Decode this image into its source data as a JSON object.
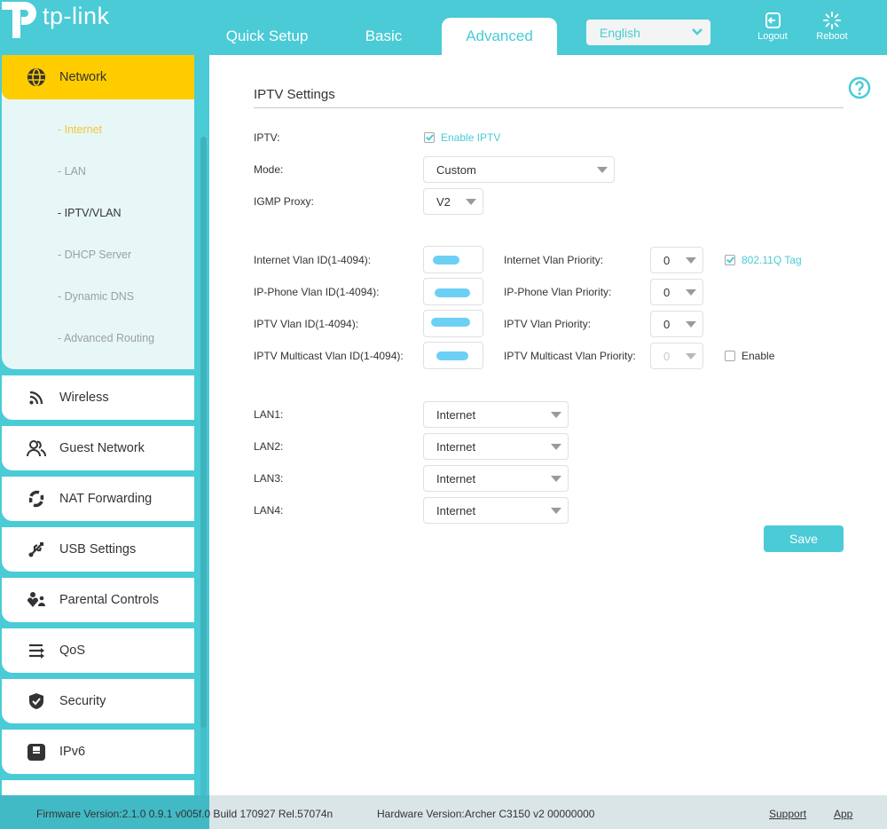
{
  "brand": {
    "name": "tp-link",
    "accent": "#4acbd6",
    "highlight": "#ffcc00"
  },
  "nav": {
    "tabs": [
      {
        "label": "Quick Setup",
        "active": false
      },
      {
        "label": "Basic",
        "active": false
      },
      {
        "label": "Advanced",
        "active": true
      }
    ],
    "language": "English",
    "logout_label": "Logout",
    "reboot_label": "Reboot"
  },
  "sidebar": {
    "active_group": {
      "label": "Network",
      "icon": "globe-icon",
      "sub_items": [
        {
          "label": "- Internet",
          "state": "hover"
        },
        {
          "label": "- LAN",
          "state": "normal"
        },
        {
          "label": "- IPTV/VLAN",
          "state": "selected"
        },
        {
          "label": "- DHCP Server",
          "state": "normal"
        },
        {
          "label": "- Dynamic DNS",
          "state": "normal"
        },
        {
          "label": "- Advanced Routing",
          "state": "normal"
        }
      ]
    },
    "items": [
      {
        "label": "Wireless",
        "icon": "wifi-icon"
      },
      {
        "label": "Guest Network",
        "icon": "guests-icon"
      },
      {
        "label": "NAT Forwarding",
        "icon": "nat-icon"
      },
      {
        "label": "USB Settings",
        "icon": "usb-icon"
      },
      {
        "label": "Parental Controls",
        "icon": "parental-icon"
      },
      {
        "label": "QoS",
        "icon": "qos-icon"
      },
      {
        "label": "Security",
        "icon": "shield-icon"
      },
      {
        "label": "IPv6",
        "icon": "ipv6-icon"
      }
    ]
  },
  "main": {
    "title": "IPTV Settings",
    "iptv": {
      "label": "IPTV:",
      "checkbox_label": "Enable IPTV",
      "checked": true
    },
    "mode": {
      "label": "Mode:",
      "value": "Custom"
    },
    "igmp": {
      "label": "IGMP Proxy:",
      "value": "V2"
    },
    "vlan_rows": [
      {
        "id_label": "Internet Vlan ID(1-4094):",
        "id_value": "[redacted]",
        "priority_label": "Internet Vlan Priority:",
        "priority_value": "0",
        "extra": {
          "label": "802.11Q Tag",
          "checked": true
        }
      },
      {
        "id_label": "IP-Phone Vlan ID(1-4094):",
        "id_value": "[redacted]",
        "priority_label": "IP-Phone Vlan Priority:",
        "priority_value": "0"
      },
      {
        "id_label": "IPTV Vlan ID(1-4094):",
        "id_value": "[redacted]",
        "priority_label": "IPTV Vlan Priority:",
        "priority_value": "0"
      },
      {
        "id_label": "IPTV Multicast Vlan ID(1-4094):",
        "id_value": "[redacted]",
        "priority_label": "IPTV Multicast Vlan Priority:",
        "priority_value": "0",
        "priority_disabled": true,
        "extra": {
          "label": "Enable",
          "checked": false
        }
      }
    ],
    "lans": [
      {
        "label": "LAN1:",
        "value": "Internet"
      },
      {
        "label": "LAN2:",
        "value": "Internet"
      },
      {
        "label": "LAN3:",
        "value": "Internet"
      },
      {
        "label": "LAN4:",
        "value": "Internet"
      }
    ],
    "save_label": "Save"
  },
  "footer": {
    "firmware": "Firmware Version:2.1.0 0.9.1 v005f.0 Build 170927 Rel.57074n",
    "hardware": "Hardware Version:Archer C3150 v2 00000000",
    "support_label": "Support",
    "app_label": "App"
  }
}
